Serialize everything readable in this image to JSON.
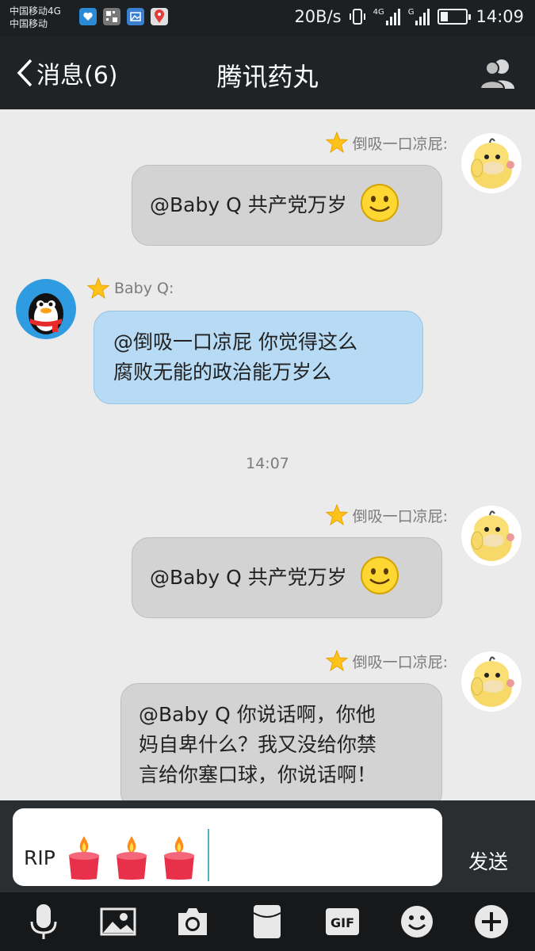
{
  "status_bar": {
    "carrier_line1": "中国移动4G",
    "carrier_line2": "中国移动",
    "speed": "20B/s",
    "net1": "4G",
    "net2": "G",
    "time": "14:09"
  },
  "header": {
    "back_label": "消息(6)",
    "title": "腾讯药丸"
  },
  "messages": [
    {
      "sender": "倒吸一口凉屁:",
      "text": "@Baby Q 共产党万岁",
      "side": "right",
      "emoji": "smile-icon"
    },
    {
      "sender": "Baby Q:",
      "text_line1": "@倒吸一口凉屁 你觉得这么",
      "text_line2": "腐败无能的政治能万岁么",
      "side": "left"
    },
    {
      "sender": "倒吸一口凉屁:",
      "text": "@Baby Q 共产党万岁",
      "side": "right",
      "emoji": "smile-icon"
    },
    {
      "sender": "倒吸一口凉屁:",
      "text_line1": "@Baby Q 你说话啊，你他",
      "text_line2": "妈自卑什么？我又没给你禁",
      "text_line3": "言给你塞口球，你说话啊！",
      "side": "right"
    }
  ],
  "timestamp": "14:07",
  "input": {
    "value": "RIP",
    "emoji": [
      "candle-icon",
      "candle-icon",
      "candle-icon"
    ],
    "send_label": "发送"
  },
  "toolbar": [
    "microphone-icon",
    "image-icon",
    "camera-icon",
    "red-packet-icon",
    "gif-icon",
    "emoji-icon",
    "plus-icon"
  ],
  "colors": {
    "title_bar": "#202326",
    "chat_background": "#ebebeb",
    "outgoing_bubble": "#d3d3d3",
    "incoming_bubble": "#b7dbf5"
  }
}
